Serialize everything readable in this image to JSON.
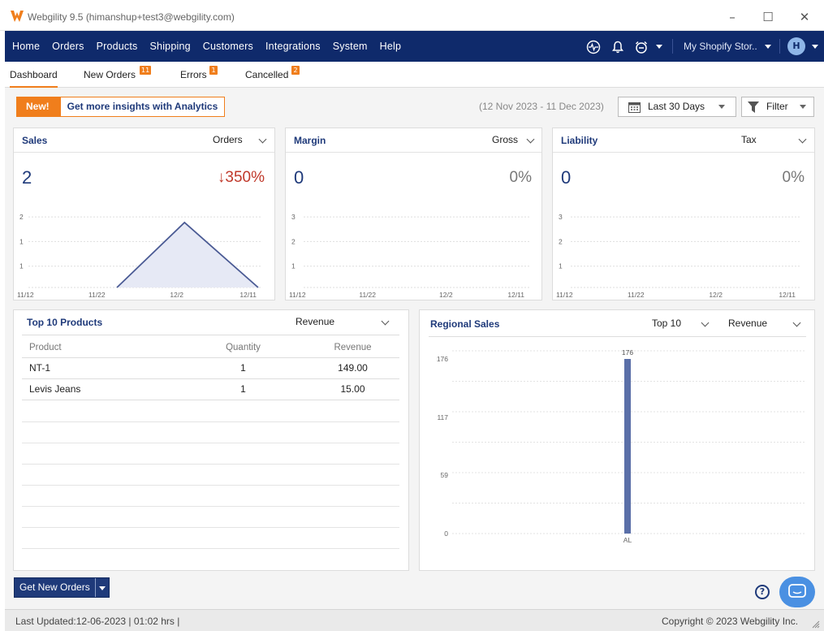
{
  "window": {
    "title": "Webgility 9.5 (himanshup+test3@webgility.com)"
  },
  "nav": {
    "items": [
      "Home",
      "Orders",
      "Products",
      "Shipping",
      "Customers",
      "Integrations",
      "System",
      "Help"
    ],
    "store_name": "My Shopify Stor..",
    "avatar_initial": "H",
    "icons": [
      "activity-icon",
      "bell-icon",
      "alarm-clock-icon"
    ]
  },
  "subtabs": [
    {
      "label": "Dashboard",
      "badge": null,
      "active": true
    },
    {
      "label": "New Orders",
      "badge": "11",
      "active": false
    },
    {
      "label": "Errors",
      "badge": "1",
      "active": false
    },
    {
      "label": "Cancelled",
      "badge": "2",
      "active": false
    }
  ],
  "toolbar": {
    "promo_new": "New!",
    "promo_text": "Get more insights with Analytics",
    "date_range": "(12 Nov 2023 - 11 Dec 2023)",
    "period": "Last 30 Days",
    "filter": "Filter"
  },
  "cards": {
    "sales": {
      "title": "Sales",
      "selector": "Orders",
      "value": "2",
      "change": "350%",
      "direction": "down"
    },
    "margin": {
      "title": "Margin",
      "selector": "Gross",
      "value": "0",
      "change": "0%"
    },
    "liability": {
      "title": "Liability",
      "selector": "Tax",
      "value": "0",
      "change": "0%"
    }
  },
  "top_products": {
    "title": "Top 10 Products",
    "selector": "Revenue",
    "columns": [
      "Product",
      "Quantity",
      "Revenue"
    ],
    "rows": [
      [
        "NT-1",
        "1",
        "149.00"
      ],
      [
        "Levis Jeans",
        "1",
        "15.00"
      ]
    ]
  },
  "regional": {
    "title": "Regional Sales",
    "selector_top": "Top 10",
    "selector_metric": "Revenue"
  },
  "actions": {
    "get_new_orders": "Get New Orders"
  },
  "status": {
    "last_updated": "Last Updated:12-06-2023 | 01:02 hrs |",
    "copyright": "Copyright © 2023 Webgility Inc."
  },
  "colors": {
    "navy": "#0f2a6b",
    "accent": "#f07e1c",
    "bar": "#5a6fa8",
    "down": "#c0392b"
  },
  "chart_data": [
    {
      "type": "area",
      "title": "Sales",
      "x": [
        "11/12",
        "11/22",
        "12/2",
        "12/11"
      ],
      "x_ticks": [
        "11/12",
        "11/22",
        "12/2",
        "12/11"
      ],
      "y_ticks": [
        "1",
        "1",
        "2"
      ],
      "series": [
        {
          "values": [
            0,
            0,
            2,
            0
          ]
        }
      ],
      "ylim": [
        0,
        2.5
      ]
    },
    {
      "type": "line",
      "title": "Margin",
      "x_ticks": [
        "11/12",
        "11/22",
        "12/2",
        "12/11"
      ],
      "y_ticks": [
        "1",
        "2",
        "3"
      ],
      "ylim": [
        0,
        3.5
      ]
    },
    {
      "type": "line",
      "title": "Liability",
      "x_ticks": [
        "11/12",
        "11/22",
        "12/2",
        "12/11"
      ],
      "y_ticks": [
        "1",
        "2",
        "3"
      ],
      "ylim": [
        0,
        3.5
      ]
    },
    {
      "type": "bar",
      "title": "Regional Sales",
      "categories": [
        "AL"
      ],
      "values": [
        176
      ],
      "data_labels": [
        "176"
      ],
      "y_ticks": [
        "0",
        "59",
        "117",
        "176"
      ],
      "ylim": [
        0,
        176
      ]
    }
  ]
}
